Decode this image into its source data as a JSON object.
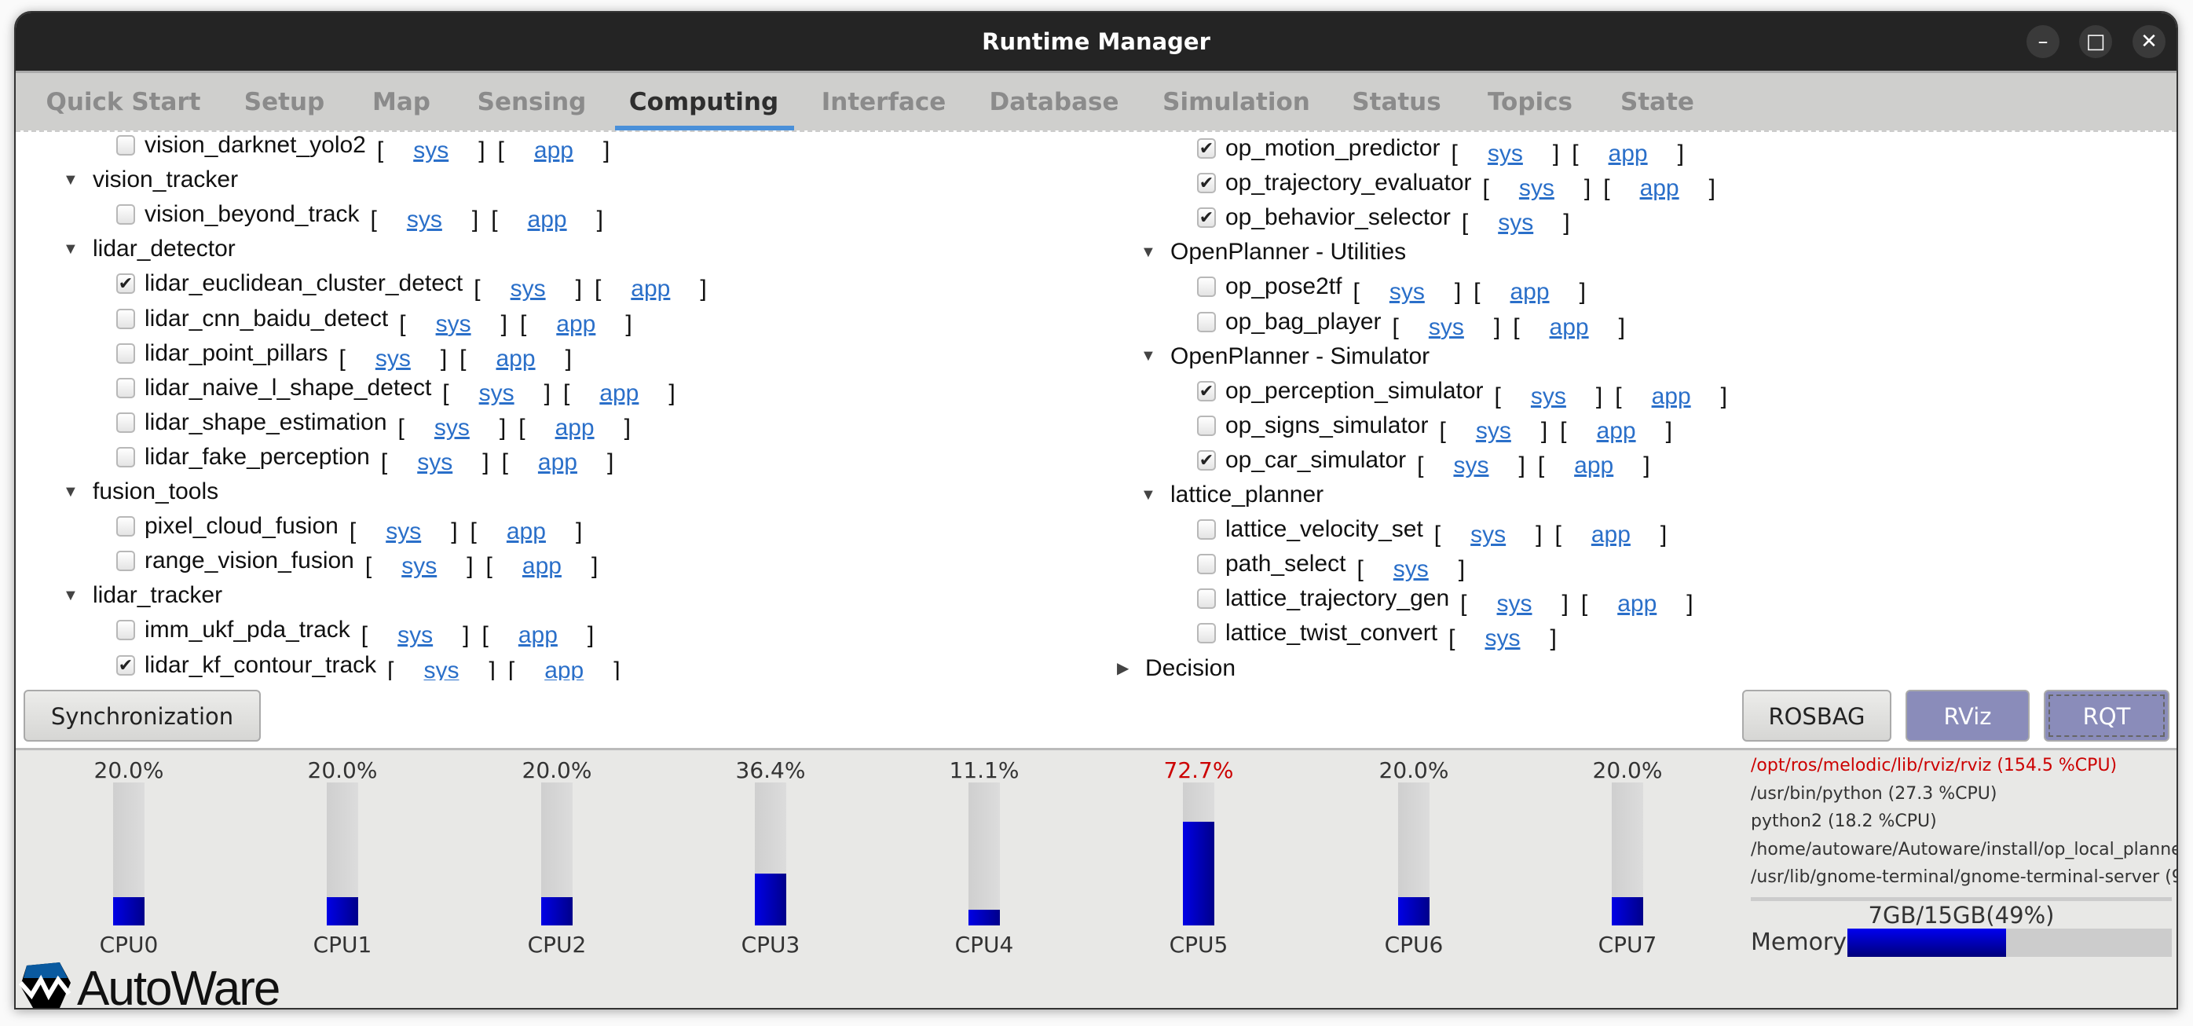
{
  "window": {
    "title": "Runtime Manager",
    "controls": [
      "minimize-icon",
      "maximize-icon",
      "close-icon"
    ]
  },
  "tabs": [
    {
      "label": "Quick Start",
      "active": false
    },
    {
      "label": "Setup",
      "active": false
    },
    {
      "label": "Map",
      "active": false
    },
    {
      "label": "Sensing",
      "active": false
    },
    {
      "label": "Computing",
      "active": true
    },
    {
      "label": "Interface",
      "active": false
    },
    {
      "label": "Database",
      "active": false
    },
    {
      "label": "Simulation",
      "active": false
    },
    {
      "label": "Status",
      "active": false
    },
    {
      "label": "Topics",
      "active": false
    },
    {
      "label": "State",
      "active": false
    }
  ],
  "tree_left": [
    {
      "type": "item",
      "label": "vision_darknet_yolo2",
      "checked": false,
      "links": [
        "sys",
        "app"
      ]
    },
    {
      "type": "category",
      "label": "vision_tracker",
      "expanded": true
    },
    {
      "type": "item",
      "label": "vision_beyond_track",
      "checked": false,
      "links": [
        "sys",
        "app"
      ]
    },
    {
      "type": "category",
      "label": "lidar_detector",
      "expanded": true
    },
    {
      "type": "item",
      "label": "lidar_euclidean_cluster_detect",
      "checked": true,
      "links": [
        "sys",
        "app"
      ]
    },
    {
      "type": "item",
      "label": "lidar_cnn_baidu_detect",
      "checked": false,
      "links": [
        "sys",
        "app"
      ]
    },
    {
      "type": "item",
      "label": "lidar_point_pillars",
      "checked": false,
      "links": [
        "sys",
        "app"
      ]
    },
    {
      "type": "item",
      "label": "lidar_naive_l_shape_detect",
      "checked": false,
      "links": [
        "sys",
        "app"
      ]
    },
    {
      "type": "item",
      "label": "lidar_shape_estimation",
      "checked": false,
      "links": [
        "sys",
        "app"
      ]
    },
    {
      "type": "item",
      "label": "lidar_fake_perception",
      "checked": false,
      "links": [
        "sys",
        "app"
      ]
    },
    {
      "type": "category",
      "label": "fusion_tools",
      "expanded": true
    },
    {
      "type": "item",
      "label": "pixel_cloud_fusion",
      "checked": false,
      "links": [
        "sys",
        "app"
      ]
    },
    {
      "type": "item",
      "label": "range_vision_fusion",
      "checked": false,
      "links": [
        "sys",
        "app"
      ]
    },
    {
      "type": "category",
      "label": "lidar_tracker",
      "expanded": true
    },
    {
      "type": "item",
      "label": "imm_ukf_pda_track",
      "checked": false,
      "links": [
        "sys",
        "app"
      ]
    },
    {
      "type": "item",
      "label": "lidar_kf_contour_track",
      "checked": true,
      "links": [
        "sys",
        "app"
      ]
    }
  ],
  "tree_right": [
    {
      "type": "item",
      "label": "op_motion_predictor",
      "checked": true,
      "links": [
        "sys",
        "app"
      ]
    },
    {
      "type": "item",
      "label": "op_trajectory_evaluator",
      "checked": true,
      "links": [
        "sys",
        "app"
      ]
    },
    {
      "type": "item",
      "label": "op_behavior_selector",
      "checked": true,
      "links": [
        "sys"
      ]
    },
    {
      "type": "category",
      "label": "OpenPlanner - Utilities",
      "expanded": true
    },
    {
      "type": "item",
      "label": "op_pose2tf",
      "checked": false,
      "links": [
        "sys",
        "app"
      ]
    },
    {
      "type": "item",
      "label": "op_bag_player",
      "checked": false,
      "links": [
        "sys",
        "app"
      ]
    },
    {
      "type": "category",
      "label": "OpenPlanner - Simulator",
      "expanded": true
    },
    {
      "type": "item",
      "label": "op_perception_simulator",
      "checked": true,
      "links": [
        "sys",
        "app"
      ]
    },
    {
      "type": "item",
      "label": "op_signs_simulator",
      "checked": false,
      "links": [
        "sys",
        "app"
      ]
    },
    {
      "type": "item",
      "label": "op_car_simulator",
      "checked": true,
      "links": [
        "sys",
        "app"
      ]
    },
    {
      "type": "category",
      "label": "lattice_planner",
      "expanded": true
    },
    {
      "type": "item",
      "label": "lattice_velocity_set",
      "checked": false,
      "links": [
        "sys",
        "app"
      ]
    },
    {
      "type": "item",
      "label": "path_select",
      "checked": false,
      "links": [
        "sys"
      ]
    },
    {
      "type": "item",
      "label": "lattice_trajectory_gen",
      "checked": false,
      "links": [
        "sys",
        "app"
      ]
    },
    {
      "type": "item",
      "label": "lattice_twist_convert",
      "checked": false,
      "links": [
        "sys"
      ]
    },
    {
      "type": "root",
      "label": "Decision",
      "expanded": false
    }
  ],
  "buttons": {
    "sync": "Synchronization",
    "rosbag": "ROSBAG",
    "rviz": "RViz",
    "rqt": "RQT"
  },
  "cpus": [
    {
      "label": "CPU0",
      "percent": 20.0,
      "text": "20.0%"
    },
    {
      "label": "CPU1",
      "percent": 20.0,
      "text": "20.0%"
    },
    {
      "label": "CPU2",
      "percent": 20.0,
      "text": "20.0%"
    },
    {
      "label": "CPU3",
      "percent": 36.4,
      "text": "36.4%"
    },
    {
      "label": "CPU4",
      "percent": 11.1,
      "text": "11.1%"
    },
    {
      "label": "CPU5",
      "percent": 72.7,
      "text": "72.7%",
      "alert": true
    },
    {
      "label": "CPU6",
      "percent": 20.0,
      "text": "20.0%"
    },
    {
      "label": "CPU7",
      "percent": 20.0,
      "text": "20.0%"
    }
  ],
  "processes": [
    {
      "text": "/opt/ros/melodic/lib/rviz/rviz (154.5 %CPU)",
      "alert": true
    },
    {
      "text": "/usr/bin/python (27.3 %CPU)"
    },
    {
      "text": "python2 (18.2 %CPU)"
    },
    {
      "text": "/home/autoware/Autoware/install/op_local_planne"
    },
    {
      "text": "/usr/lib/gnome-terminal/gnome-terminal-server (9"
    }
  ],
  "memory": {
    "label": "Memory",
    "text": "7GB/15GB(49%)",
    "percent": 49
  },
  "logo": {
    "text": "AutoWare"
  },
  "colors": {
    "link": "#2a6fc9",
    "alert": "#cc0000",
    "bar_fill": "#0000e6",
    "accent_tab": "#4a90d9",
    "purple_button": "#8a8cba"
  }
}
